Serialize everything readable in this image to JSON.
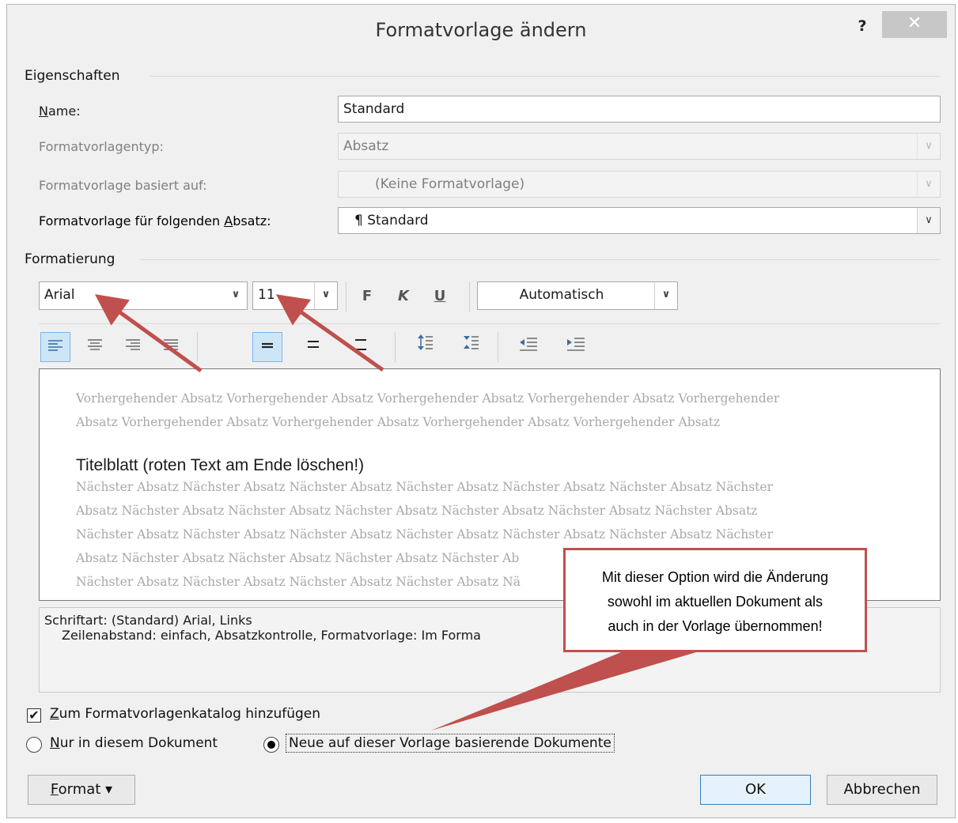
{
  "title": "Formatvorlage ändern",
  "help_label": "?",
  "close_label": "✕",
  "eigenschaften": {
    "heading": "Eigenschaften",
    "name_label": "Name:",
    "name_value": "Standard",
    "typ_label": "Formatvorlagentyp:",
    "typ_value": "Absatz",
    "basiert_label": "Formatvorlage basiert auf:",
    "basiert_value": "(Keine Formatvorlage)",
    "folgend_label": "Formatvorlage für folgenden Absatz:",
    "folgend_value": "¶ Standard"
  },
  "formatierung": {
    "heading": "Formatierung",
    "font": "Arial",
    "size": "11",
    "bold": "F",
    "italic": "K",
    "underline": "U",
    "color": "Automatisch"
  },
  "preview": {
    "previous_lines": [
      "Vorhergehender Absatz Vorhergehender Absatz Vorhergehender Absatz Vorhergehender Absatz Vorhergehender",
      "Absatz Vorhergehender Absatz Vorhergehender Absatz Vorhergehender Absatz Vorhergehender Absatz"
    ],
    "title_text": "Titelblatt (roten Text am Ende löschen!)",
    "next_lines": [
      "Nächster Absatz Nächster Absatz Nächster Absatz Nächster Absatz Nächster Absatz Nächster Absatz Nächster",
      "Absatz Nächster Absatz Nächster Absatz Nächster Absatz Nächster Absatz Nächster Absatz Nächster Absatz",
      "Nächster Absatz Nächster Absatz Nächster Absatz Nächster Absatz Nächster Absatz Nächster Absatz Nächster",
      "Absatz Nächster Absatz Nächster Absatz Nächster Absatz Nächster Ab",
      "Nächster Absatz Nächster Absatz Nächster Absatz Nächster Absatz Nä"
    ]
  },
  "description": {
    "line1": "Schriftart: (Standard) Arial, Links",
    "line2": "Zeilenabstand:  einfach, Absatzkontrolle, Formatvorlage: Im Forma"
  },
  "options": {
    "katalog_label": "Zum Formatvorlagenkatalog hinzufügen",
    "katalog_checked": true,
    "nur_dokument_label": "Nur in diesem Dokument",
    "vorlage_label": "Neue auf dieser Vorlage basierende Dokumente"
  },
  "buttons": {
    "format": "Format",
    "ok": "OK",
    "abbrechen": "Abbrechen"
  },
  "callout": {
    "line1": "Mit dieser Option wird die Änderung",
    "line2": "sowohl im aktuellen Dokument als",
    "line3": "auch in der Vorlage übernommen!"
  },
  "icons": {
    "align_left": "align-left-icon",
    "align_center": "align-center-icon",
    "align_right": "align-right-icon",
    "justify": "justify-icon",
    "line_single": "single-spacing-icon",
    "line_onehalf": "onehalf-spacing-icon",
    "line_double": "double-spacing-icon",
    "space_before": "increase-paragraph-spacing-icon",
    "space_after": "decrease-paragraph-spacing-icon",
    "indent_decrease": "decrease-indent-icon",
    "indent_increase": "increase-indent-icon"
  },
  "colors": {
    "accent_red": "#c0504d",
    "active_blue": "#cde6f7"
  }
}
